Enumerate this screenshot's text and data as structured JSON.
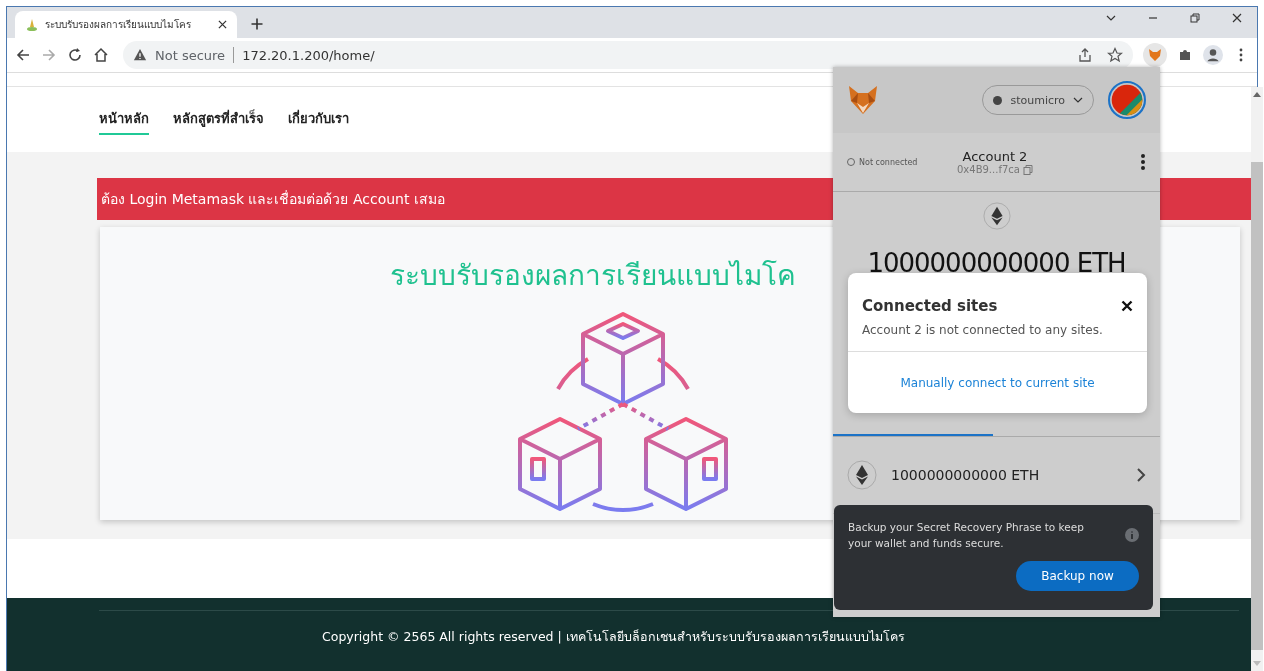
{
  "browser": {
    "tab_title": "ระบบรับรองผลการเรียนแบบไมโคร",
    "security": "Not secure",
    "url": "172.20.1.200/home/"
  },
  "nav": [
    {
      "label": "หน้าหลัก",
      "selected": true
    },
    {
      "label": "หลักสูตรที่สำเร็จ",
      "selected": false
    },
    {
      "label": "เกี่ยวกับเรา",
      "selected": false
    }
  ],
  "alert": "ต้อง Login Metamask และเชื่อมต่อด้วย Account เสมอ",
  "hero": {
    "title": "ระบบรับรองผลการเรียนแบบไมโค"
  },
  "footer": "Copyright © 2565 All rights reserved | เทคโนโลยีบล็อกเชนสำหรับระบบรับรองผลการเรียนแบบไมโคร",
  "wallet": {
    "network": "stoumicro",
    "connection": "Not connected",
    "account": "Account 2",
    "address": "0x4B9...f7ca",
    "balance": "1000000000000 ETH",
    "assets": [
      {
        "amount": "1000000000000 ETH"
      }
    ]
  },
  "modal": {
    "title": "Connected sites",
    "message": "Account 2 is not connected to any sites.",
    "link": "Manually connect to current site"
  },
  "toast": {
    "message": "Backup your Secret Recovery Phrase to keep your wallet and funds secure.",
    "button": "Backup now"
  }
}
